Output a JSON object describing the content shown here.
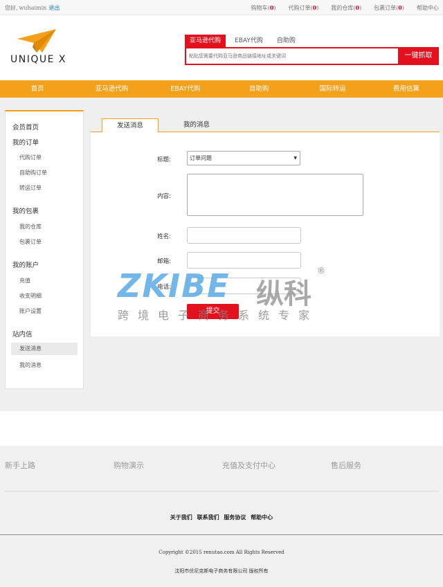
{
  "topbar": {
    "greeting": "您好,",
    "username": "wuhaimin",
    "logout": "退出",
    "links": [
      {
        "label": "购物车",
        "count": "0"
      },
      {
        "label": "代购订单",
        "count": "0"
      },
      {
        "label": "我的仓库",
        "count": "0"
      },
      {
        "label": "包裹订单",
        "count": "0"
      },
      {
        "label": "帮助中心",
        "count": ""
      }
    ]
  },
  "header": {
    "logo_text": "UNIQUE X",
    "search_tabs": [
      "亚马逊代购",
      "EBAY代购",
      "自助购"
    ],
    "search_placeholder": "粘贴您需要代购亚马逊商品链接地址或关键词",
    "search_button": "一键抓取"
  },
  "nav": [
    "首页",
    "亚马逊代购",
    "EBAY代购",
    "自助购",
    "国际转运",
    "费用估算"
  ],
  "sidebar": {
    "home": "会员首页",
    "orders_title": "我的订单",
    "orders": [
      "代购订单",
      "自助购订单",
      "转运订单"
    ],
    "parcels_title": "我的包裹",
    "parcels": [
      "我的仓库",
      "包裹订单"
    ],
    "account_title": "我的账户",
    "account": [
      "充值",
      "收支明细",
      "账户设置"
    ],
    "messages_title": "站内信",
    "messages": [
      "发送消息",
      "我的消息"
    ]
  },
  "content": {
    "tabs": [
      "发送消息",
      "我的消息"
    ],
    "form": {
      "title_label": "标题:",
      "title_value": "订单问题",
      "content_label": "内容:",
      "name_label": "姓名:",
      "email_label": "邮箱:",
      "phone_label": "电话:",
      "submit": "提交"
    }
  },
  "watermark": {
    "brand": "ZKIBE",
    "brand_cn": "纵科",
    "registered": "®",
    "tagline": "跨境电子商务系统专家"
  },
  "footer": {
    "columns": [
      "新手上路",
      "购物演示",
      "充值及支付中心",
      "售后服务"
    ],
    "links": [
      "关于我们",
      "联系我们",
      "服务协议",
      "帮助中心"
    ],
    "copyright": "Copyright ©2015 renutao.com All Rights Reserved",
    "company": "沈阳市优尼克斯电子商务有限公司 版权所有"
  },
  "colors": {
    "accent_orange": "#f3a01a",
    "accent_red": "#e3101d",
    "watermark_blue": "#5aaae6"
  }
}
